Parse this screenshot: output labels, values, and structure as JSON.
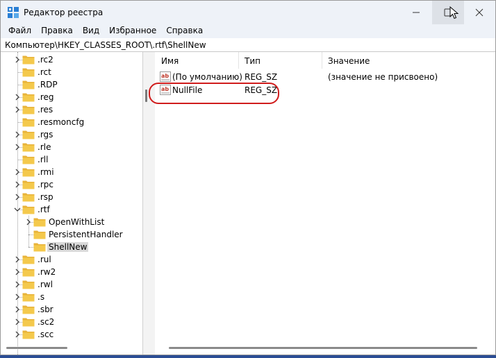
{
  "window": {
    "title": "Редактор реестра",
    "controls": {
      "minimize": "minimize",
      "maximize": "maximize",
      "close": "close"
    }
  },
  "menu": [
    "Файл",
    "Правка",
    "Вид",
    "Избранное",
    "Справка"
  ],
  "address": "Компьютер\\HKEY_CLASSES_ROOT\\.rtf\\ShellNew",
  "tree": {
    "items": [
      {
        "label": ".rc2",
        "level": 0,
        "expander": "collapsed"
      },
      {
        "label": ".rct",
        "level": 0,
        "expander": "none"
      },
      {
        "label": ".RDP",
        "level": 0,
        "expander": "none"
      },
      {
        "label": ".reg",
        "level": 0,
        "expander": "collapsed"
      },
      {
        "label": ".res",
        "level": 0,
        "expander": "collapsed"
      },
      {
        "label": ".resmoncfg",
        "level": 0,
        "expander": "none"
      },
      {
        "label": ".rgs",
        "level": 0,
        "expander": "collapsed"
      },
      {
        "label": ".rle",
        "level": 0,
        "expander": "collapsed"
      },
      {
        "label": ".rll",
        "level": 0,
        "expander": "none"
      },
      {
        "label": ".rmi",
        "level": 0,
        "expander": "collapsed"
      },
      {
        "label": ".rpc",
        "level": 0,
        "expander": "collapsed"
      },
      {
        "label": ".rsp",
        "level": 0,
        "expander": "collapsed"
      },
      {
        "label": ".rtf",
        "level": 0,
        "expander": "expanded"
      },
      {
        "label": "OpenWithList",
        "level": 1,
        "expander": "collapsed"
      },
      {
        "label": "PersistentHandler",
        "level": 1,
        "expander": "none"
      },
      {
        "label": "ShellNew",
        "level": 1,
        "expander": "none",
        "selected": true
      },
      {
        "label": ".rul",
        "level": 0,
        "expander": "collapsed"
      },
      {
        "label": ".rw2",
        "level": 0,
        "expander": "collapsed"
      },
      {
        "label": ".rwl",
        "level": 0,
        "expander": "collapsed"
      },
      {
        "label": ".s",
        "level": 0,
        "expander": "collapsed"
      },
      {
        "label": ".sbr",
        "level": 0,
        "expander": "collapsed"
      },
      {
        "label": ".sc2",
        "level": 0,
        "expander": "collapsed"
      },
      {
        "label": ".scc",
        "level": 0,
        "expander": "collapsed"
      }
    ]
  },
  "list": {
    "columns": {
      "name": "Имя",
      "type": "Тип",
      "value": "Значение"
    },
    "rows": [
      {
        "name": "(По умолчанию)",
        "type": "REG_SZ",
        "value": "(значение не присвоено)",
        "icon": "string-value-icon"
      },
      {
        "name": "NullFile",
        "type": "REG_SZ",
        "value": "",
        "icon": "string-value-icon",
        "highlighted": true
      }
    ]
  },
  "colors": {
    "highlight": "#d01c1c",
    "folder": "#f4c94c",
    "titlebar": "#eef2f8"
  }
}
